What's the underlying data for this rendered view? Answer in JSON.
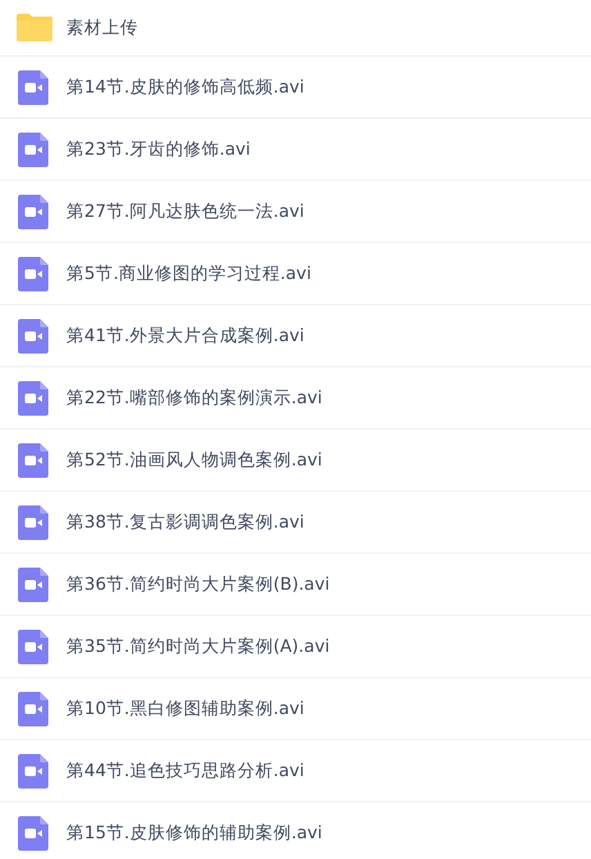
{
  "files": [
    {
      "kind": "folder",
      "name": "素材上传"
    },
    {
      "kind": "video",
      "name": "第14节.皮肤的修饰高低频.avi"
    },
    {
      "kind": "video",
      "name": "第23节.牙齿的修饰.avi"
    },
    {
      "kind": "video",
      "name": "第27节.阿凡达肤色统一法.avi"
    },
    {
      "kind": "video",
      "name": "第5节.商业修图的学习过程.avi"
    },
    {
      "kind": "video",
      "name": "第41节.外景大片合成案例.avi"
    },
    {
      "kind": "video",
      "name": "第22节.嘴部修饰的案例演示.avi"
    },
    {
      "kind": "video",
      "name": "第52节.油画风人物调色案例.avi"
    },
    {
      "kind": "video",
      "name": "第38节.复古影调调色案例.avi"
    },
    {
      "kind": "video",
      "name": "第36节.简约时尚大片案例(B).avi"
    },
    {
      "kind": "video",
      "name": "第35节.简约时尚大片案例(A).avi"
    },
    {
      "kind": "video",
      "name": "第10节.黑白修图辅助案例.avi"
    },
    {
      "kind": "video",
      "name": "第44节.追色技巧思路分析.avi"
    },
    {
      "kind": "video",
      "name": "第15节.皮肤修饰的辅助案例.avi"
    }
  ]
}
